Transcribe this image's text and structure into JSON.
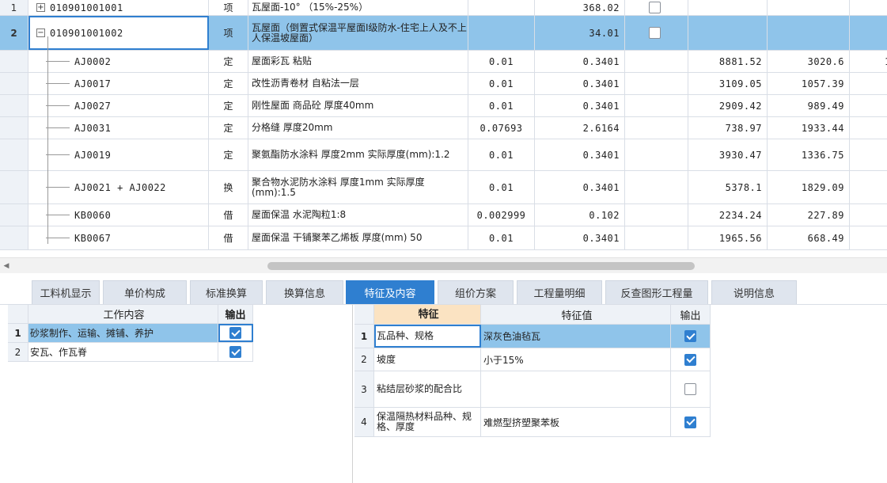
{
  "grid": {
    "rows": [
      {
        "num": "1",
        "code": "010901001001",
        "category": "项",
        "name": "瓦屋面-10° （15%-25%）",
        "unit_qty": "",
        "quantity": "368.02",
        "checked": false,
        "price1": "",
        "price2": "",
        "price3": "",
        "toggle": "+"
      },
      {
        "num": "2",
        "code": "010901001002",
        "category": "项",
        "name": "瓦屋面（倒置式保温平屋面I级防水-住宅上人及不上人保温坡屋面）",
        "unit_qty": "",
        "quantity": "34.01",
        "checked": false,
        "price1": "",
        "price2": "",
        "price3": "",
        "toggle": "−"
      },
      {
        "num": "",
        "code": "AJ0002",
        "category": "定",
        "name": "屋面彩瓦 粘贴",
        "unit_qty": "0.01",
        "quantity": "0.3401",
        "price1": "8881.52",
        "price2": "3020.6",
        "price3": "1"
      },
      {
        "num": "",
        "code": "AJ0017",
        "category": "定",
        "name": "改性沥青卷材 自粘法一层",
        "unit_qty": "0.01",
        "quantity": "0.3401",
        "price1": "3109.05",
        "price2": "1057.39",
        "price3": ""
      },
      {
        "num": "",
        "code": "AJ0027",
        "category": "定",
        "name": "刚性屋面 商品砼 厚度40mm",
        "unit_qty": "0.01",
        "quantity": "0.3401",
        "price1": "2909.42",
        "price2": "989.49",
        "price3": ""
      },
      {
        "num": "",
        "code": "AJ0031",
        "category": "定",
        "name": "分格缝 厚度20mm",
        "unit_qty": "0.07693",
        "quantity": "2.6164",
        "price1": "738.97",
        "price2": "1933.44",
        "price3": ""
      },
      {
        "num": "",
        "code": "AJ0019",
        "category": "定",
        "name": "聚氨酯防水涂料 厚度2mm  实际厚度(mm):1.2",
        "unit_qty": "0.01",
        "quantity": "0.3401",
        "price1": "3930.47",
        "price2": "1336.75",
        "price3": ""
      },
      {
        "num": "",
        "code": "AJ0021 + AJ0022",
        "category": "换",
        "name": "聚合物水泥防水涂料 厚度1mm  实际厚度(mm):1.5",
        "unit_qty": "0.01",
        "quantity": "0.3401",
        "price1": "5378.1",
        "price2": "1829.09",
        "price3": ""
      },
      {
        "num": "",
        "code": "KB0060",
        "category": "借",
        "name": "屋面保温 水泥陶粒1:8",
        "unit_qty": "0.002999",
        "quantity": "0.102",
        "price1": "2234.24",
        "price2": "227.89",
        "price3": ""
      },
      {
        "num": "",
        "code": "KB0067",
        "category": "借",
        "name": "屋面保温 干铺聚苯乙烯板 厚度(mm) 50",
        "unit_qty": "0.01",
        "quantity": "0.3401",
        "price1": "1965.56",
        "price2": "668.49",
        "price3": ""
      }
    ]
  },
  "tabs": [
    {
      "label": "工料机显示",
      "active": false
    },
    {
      "label": "单价构成",
      "active": false
    },
    {
      "label": "标准换算",
      "active": false
    },
    {
      "label": "换算信息",
      "active": false
    },
    {
      "label": "特征及内容",
      "active": true
    },
    {
      "label": "组价方案",
      "active": false
    },
    {
      "label": "工程量明细",
      "active": false
    },
    {
      "label": "反查图形工程量",
      "active": false
    },
    {
      "label": "说明信息",
      "active": false
    }
  ],
  "work_content": {
    "header": {
      "col_content": "工作内容",
      "col_output": "输出"
    },
    "rows": [
      {
        "num": "1",
        "content": "砂浆制作、运输、摊铺、养护",
        "output": true
      },
      {
        "num": "2",
        "content": "安瓦、作瓦脊",
        "output": true
      }
    ]
  },
  "features": {
    "header": {
      "col_feature": "特征",
      "col_value": "特征值",
      "col_output": "输出"
    },
    "rows": [
      {
        "num": "1",
        "feature": "瓦品种、规格",
        "value": "深灰色油毡瓦",
        "output": true
      },
      {
        "num": "2",
        "feature": "坡度",
        "value": "小于15%",
        "output": true
      },
      {
        "num": "3",
        "feature": "粘结层砂浆的配合比",
        "value": "",
        "output": false
      },
      {
        "num": "4",
        "feature": "保温隔热材料品种、规格、厚度",
        "value": "难燃型挤塑聚苯板",
        "output": true
      }
    ]
  },
  "colors": {
    "accent": "#2f7fd0",
    "selection": "#8fc4ea",
    "header_bg": "#eef2f7",
    "feature_header": "#fbe3c2"
  }
}
